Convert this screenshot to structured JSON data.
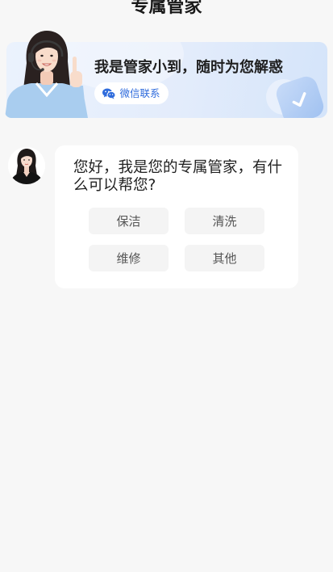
{
  "header": {
    "title": "专属管家"
  },
  "banner": {
    "headline": "我是管家小到，随时为您解惑",
    "wechat_button": {
      "label": "微信联系"
    }
  },
  "chat": {
    "message": "您好，我是您的专属管家，有什么可以帮您?",
    "options": [
      {
        "label": "保洁"
      },
      {
        "label": "清洗"
      },
      {
        "label": "维修"
      },
      {
        "label": "其他"
      }
    ]
  },
  "icons": {
    "wechat": "wechat-icon",
    "decoration": "check-icon"
  },
  "colors": {
    "page_background": "#f7f7f7",
    "banner_background": "#e3ecfb",
    "accent_blue": "#2e6bdc",
    "option_background": "#f4f4f4"
  }
}
